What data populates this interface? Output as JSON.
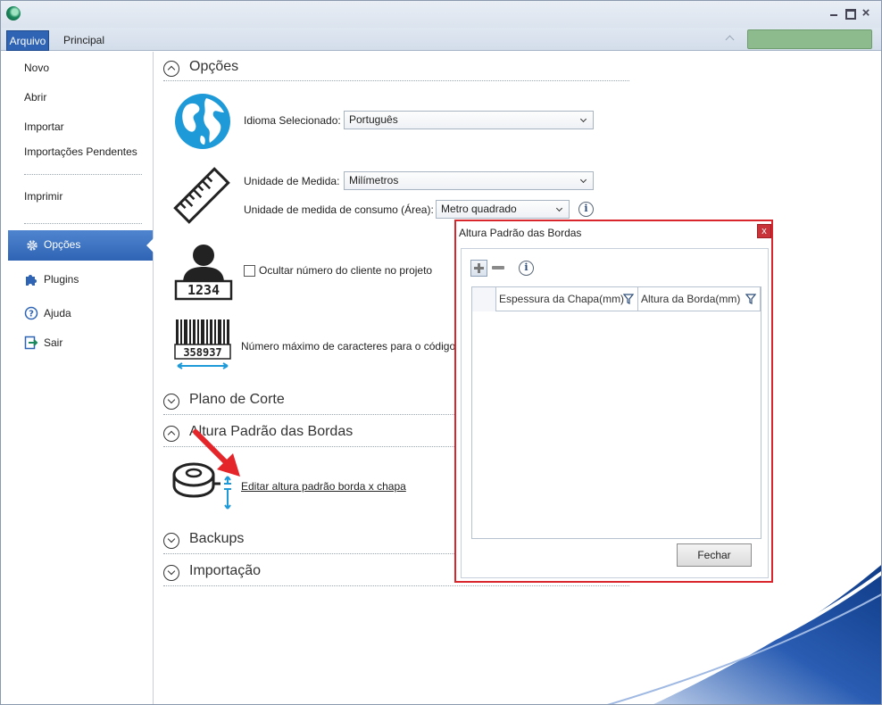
{
  "window": {
    "min_icon": "minimize-icon",
    "max_icon": "maximize-icon",
    "close_label": "×"
  },
  "ribbon": {
    "tabs": [
      {
        "label": "Arquivo",
        "active": true
      },
      {
        "label": "Principal",
        "active": false
      }
    ],
    "status_color": "#8dbb8d",
    "accent": "#2f64b5"
  },
  "sidebar": {
    "items": [
      {
        "label": "Novo"
      },
      {
        "label": "Abrir"
      },
      {
        "label": "Importar"
      },
      {
        "label": "Importações Pendentes"
      },
      {
        "label": "Imprimir"
      },
      {
        "label": "Opções",
        "icon": "gear-icon",
        "selected": true
      },
      {
        "label": "Plugins",
        "icon": "puzzle-icon"
      },
      {
        "label": "Ajuda",
        "icon": "help-icon"
      },
      {
        "label": "Sair",
        "icon": "exit-icon"
      }
    ]
  },
  "options": {
    "section_title": "Opções",
    "language": {
      "icon": "globe-icon",
      "label": "Idioma Selecionado:",
      "value": "Português"
    },
    "measure": {
      "icon": "ruler-icon",
      "label": "Unidade de Medida:",
      "value": "Milímetros",
      "consumption_label": "Unidade de medida de consumo (Área):",
      "consumption_value": "Metro quadrado"
    },
    "client": {
      "icon": "client-id-icon",
      "badge": "1234",
      "checkbox_label": "Ocultar número do cliente no projeto",
      "checked": false
    },
    "barcode": {
      "icon": "barcode-icon",
      "digits": "358937",
      "label": "Número máximo de caracteres para o código"
    }
  },
  "sections": {
    "plano": "Plano de Corte",
    "altura": "Altura Padrão das Bordas",
    "altura_link": "Editar altura padrão borda x chapa",
    "backups": "Backups",
    "importacao": "Importação"
  },
  "dialog": {
    "title": "Altura Padrão das Bordas",
    "close_label": "x",
    "columns": [
      "Espessura da Chapa(mm)",
      "Altura da Borda(mm)"
    ],
    "rows": [],
    "close_button": "Fechar"
  }
}
